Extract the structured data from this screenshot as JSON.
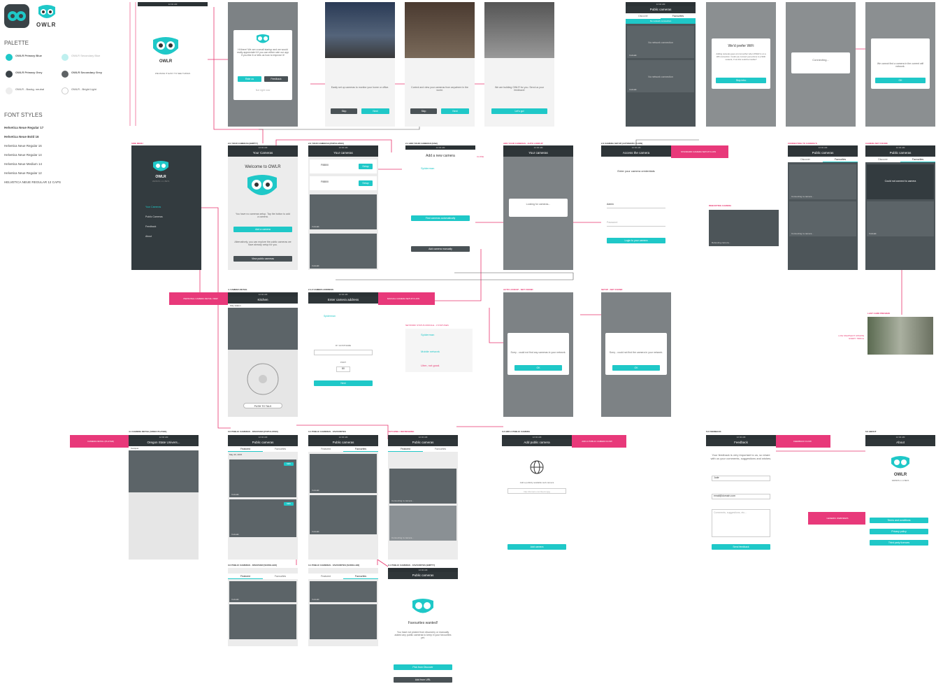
{
  "brand": {
    "name": "OWLR"
  },
  "palette": {
    "title": "PALETTE",
    "swatches": [
      {
        "name": "OWLR Primary Blue",
        "info": "RGB 71 200 196\n#1fc8c8",
        "color": "#1fc8c8"
      },
      {
        "name": "OWLR Secondary Blue",
        "info": "RGB 196 240 240",
        "color": "#bff0ef"
      },
      {
        "name": "OWLR Primary Grey",
        "info": "RGB 58 66 71\n#3a4247",
        "color": "#3a4247"
      },
      {
        "name": "OWLR Secondary Grey",
        "info": "RGB 94 99 101\n#5e6365",
        "color": "#5e6365"
      },
      {
        "name": "OWLR - Backg. neutral",
        "info": "RGB 237 236 237\n#ededed",
        "color": "#ededed"
      },
      {
        "name": "OWLR - Bright Light",
        "info": "RGB 255 255 255\n#ffffff",
        "color": "#ffffff"
      }
    ]
  },
  "fonts": {
    "title": "FONT STYLES",
    "items": [
      "Helvetica Neue Regular 17",
      "Helvetica Neue Bold 16",
      "Helvetica Neue Regular 16",
      "Helvetica Neue Regular 14",
      "Helvetica Neue Medium 14",
      "Helvetica Neue Regular 12",
      "HELVETICA NEUE REGULAR 12 CAPS"
    ]
  },
  "status": {
    "carrier": "Carrier",
    "time": "12:04 AM",
    "battery": "100%"
  },
  "screens": {
    "splash": {
      "tagline": "WE MAKE IT EASY TO SEE THINGS"
    },
    "rate": {
      "text": "Hi there! We are a small startup and we would really appreciate it if you can either rate our app if you like it or tells us how to improve it!",
      "rate": "Rate us",
      "feedback": "Feedback",
      "later": "Not right now"
    },
    "onb1": {
      "text": "Easily set up cameras to monitor your home or office.",
      "skip": "Skip",
      "next": "Next"
    },
    "onb2": {
      "text": "Control and view your cameras from anywhere in the world.",
      "skip": "Skip",
      "next": "Next"
    },
    "onb3": {
      "text": "We are building OWLR for you. Send us your feedback!",
      "go": "Let's go!"
    },
    "pub": {
      "title": "Public cameras",
      "tab1": "Discover",
      "tab2": "Favourites",
      "banner": "No network connection",
      "card": "No network connection",
      "cam": "Catwalk"
    },
    "wifi": {
      "title": "We'd prefer WiFi",
      "text": "Adding cameras goes a lot smoother when OWLR is on a Wifi connection. Could you connect your phone to a WiFi network, if not this could be trouble?",
      "btn": "Skip intro"
    },
    "connecting": {
      "text": "Connecting..."
    },
    "nocam": {
      "text": "We cannot find a camera in the current wifi network.",
      "btn": "OK"
    },
    "menu": {
      "section": "SIDE MENU",
      "items": [
        "Your Cameras",
        "Public Cameras",
        "Feedback",
        "About"
      ],
      "version": "VERSION 1.1.2 BETA"
    },
    "empty": {
      "section": "2.0 YOUR CAMERAS [EMPTY]",
      "title": "Your Cameras",
      "welcome": "Welcome to OWLR",
      "text": "You have no cameras setup. Tap the button to add a camera.",
      "add": "Add a camera",
      "text2": "Alternatively, you can explore the public cameras we have already setup for you.",
      "view": "View public cameras"
    },
    "populated": {
      "section": "2.0 YOUR CAMERAS [POPULATED]",
      "title": "Your cameras",
      "cam1": "FI8800",
      "cam2": "FI8800",
      "setup": "Setup",
      "cam": "Catwalk"
    },
    "addcam": {
      "section": "2.1 ADD YOUR CAMERAS [FAB]",
      "title": "Add a new camera",
      "network": "Spiderman",
      "auto": "Find cameras automatically",
      "manual": "Add camera manually",
      "close": "CLOSE"
    },
    "lookup": {
      "section": "ADD YOUR CAMERAS - AUTO LOOKUP",
      "title": "Your cameras",
      "text": "Looking for cameras..."
    },
    "access": {
      "section": "2.3 CAMERA SETUP [AUTOMATIC FLOW]",
      "title": "Access the camera",
      "heading": "Enter your camera credentials",
      "user": "Admin",
      "pass": "Password",
      "login": "Login to your camera",
      "flag": "STANDARD CAMERA SETUP FLOW"
    },
    "detail": {
      "section": "4. CAMERA DETAIL",
      "title": "Kitchen",
      "back": "BACK",
      "live": "Kitty station",
      "date": "Sat, 20th Jan 2015",
      "talk": "PUSH TO TALK",
      "flag": "PERSONAL CAMERA DETAIL VIEW"
    },
    "address": {
      "section": "2.1.2 CAMERA ADDRESS",
      "title": "Enter camera address",
      "back": "BACK",
      "network": "Spiderman",
      "ip": "IP / HOSTNAME",
      "port": "PORT",
      "portval": "80",
      "next": "Next",
      "flag": "MANUAL CAMERA SETUP FLOW"
    },
    "netstatus": {
      "section": "NETWORK STATUS MODULE - 3 STATUSES",
      "s1": "Spiderman",
      "s2": "Mobile network",
      "s3": "Uhm, not good."
    },
    "notfound": {
      "section": "AUTO LOOKUP - NOT FOUND",
      "text": "Sorry - could not find any cameras in your network.",
      "btn": "OK"
    },
    "notfound2": {
      "section": "SETUP - NOT FOUND",
      "text": "Sorry - could not find the camera in your network.",
      "btn": "OK"
    },
    "rebooting": {
      "section": "REBOOTING CAMERA",
      "text": "Rebooting camera..."
    },
    "connectingcam": {
      "section": "CONNECTING TO CAMERA'S",
      "text": "Connecting to camera..."
    },
    "camnotfound": {
      "section": "CAMERA NOT FOUND",
      "text": "Could not connect to camera"
    },
    "lastcard": {
      "section": "LAST CARD PREVIEW",
      "note": "LIVE SNAPSHOT UPDATE EVERY 7000ms"
    },
    "player": {
      "section": "4.1 CAMERA DETAIL [VIDEO PLAYER]",
      "title": "Oregon State Univers...",
      "back": "BACK",
      "date": "Sat, 20th Jan 2015",
      "live": "Campus",
      "flag": "CAMERA DETAIL (PLAYER)"
    },
    "discover": {
      "section": "3.0 PUBLIC CAMERAS - DISCOVER [POPULATED]",
      "title": "Public cameras",
      "date": "May 20, 2015",
      "new": "NEW",
      "cam": "Catwalk"
    },
    "favs": {
      "section": "3.1 PUBLIC CAMERAS - FAVOURITES",
      "title": "Public cameras"
    },
    "fetching": {
      "section": "FETCHING / REFRESHING",
      "title": "Public cameras",
      "text": "Connecting to camera..."
    },
    "addpublic": {
      "section": "3.3 ADD A PUBLIC CAMERA",
      "title": "Add public camera",
      "text": "Add a publicly available web camera",
      "url": "http://domain.com/feed.mjpg",
      "btn": "Add camera",
      "flag": "ADD A PUBLIC CAMERA FLOW"
    },
    "feedback": {
      "section": "5.0 FEEDBACK",
      "title": "Feedback",
      "text": "Your feedback is very important to us, so share with us your comments, suggestions and wishes.",
      "name": "Jude",
      "email": "email@domain.com",
      "comments": "Comments, suggestions, etc...",
      "send": "Send feedback",
      "flag": "FEEDBACK FLOW"
    },
    "about": {
      "section": "6.0 ABOUT",
      "title": "About",
      "version": "VERSION 1.1.2 BETA",
      "terms": "Terms and conditions",
      "privacy": "Privacy policy",
      "licences": "Third party licences",
      "flag": "GENERIC WEBVIEWS"
    },
    "discscroll": {
      "section": "3.0 PUBLIC CAMERAS - DISCOVER [SCROLLED]"
    },
    "favscroll": {
      "section": "3.1 PUBLIC CAMERAS - FAVOURITES [SCROLLED]"
    },
    "favempty": {
      "section": "3.1 PUBLIC CAMERAS - FAVOURITES [EMPTY]",
      "title": "Public cameras",
      "heading": "Favourites wanted!",
      "text": "You have not picked from discovery or manually added any public cameras to keep in your favourites yet.",
      "pick": "Pick from Discover",
      "url": "Add from URL"
    }
  }
}
